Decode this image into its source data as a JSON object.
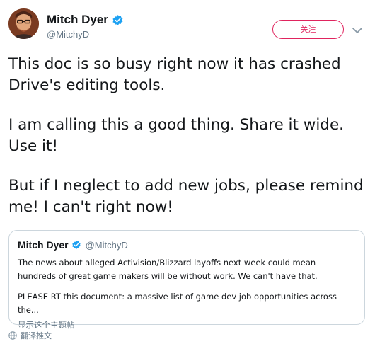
{
  "author": {
    "name": "Mitch Dyer",
    "handle": "@MitchyD",
    "verified_color": "#1da1f2"
  },
  "follow_button": {
    "label": "关注",
    "color": "#e0245e"
  },
  "icons": {
    "avatar": "profile-photo",
    "verified": "verified-badge-icon",
    "more": "chevron-down-icon",
    "translate": "globe-icon"
  },
  "tweet": {
    "paragraphs": [
      "This doc is so busy right now it has crashed Drive's editing tools.",
      "I am calling this a good thing. Share it wide. Use it!",
      "But if I neglect to add new jobs, please remind me! I can't right now!"
    ]
  },
  "quoted_tweet": {
    "name": "Mitch Dyer",
    "handle": "@MitchyD",
    "paragraph_1": "The news about alleged Activision/Blizzard layoffs next week could mean hundreds of great game makers will be without work. We can't have that.",
    "paragraph_2": "PLEASE RT this document: a massive list of game dev job opportunities across the...",
    "show_thread": "显示这个主题帖"
  },
  "footer": {
    "translate_label": "翻译推文"
  }
}
